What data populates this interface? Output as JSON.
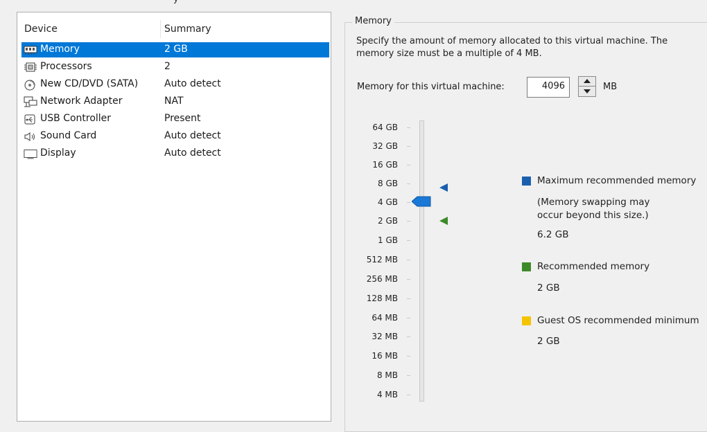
{
  "window": {
    "cropped_title": "y"
  },
  "device_list": {
    "headers": {
      "device": "Device",
      "summary": "Summary"
    },
    "rows": [
      {
        "icon": "memory-icon",
        "name": "Memory",
        "summary": "2 GB",
        "selected": true
      },
      {
        "icon": "processor-icon",
        "name": "Processors",
        "summary": "2",
        "selected": false
      },
      {
        "icon": "cd-dvd-icon",
        "name": "New CD/DVD (SATA)",
        "summary": "Auto detect",
        "selected": false
      },
      {
        "icon": "network-adapter-icon",
        "name": "Network Adapter",
        "summary": "NAT",
        "selected": false
      },
      {
        "icon": "usb-icon",
        "name": "USB Controller",
        "summary": "Present",
        "selected": false
      },
      {
        "icon": "speaker-icon",
        "name": "Sound Card",
        "summary": "Auto detect",
        "selected": false
      },
      {
        "icon": "display-icon",
        "name": "Display",
        "summary": "Auto detect",
        "selected": false
      }
    ]
  },
  "memory": {
    "group_title": "Memory",
    "description": "Specify the amount of memory allocated to this virtual machine. The memory size must be a multiple of 4 MB.",
    "field_label": "Memory for this virtual machine:",
    "value": "4096",
    "unit": "MB",
    "scale": [
      "64 GB",
      "32 GB",
      "16 GB",
      "8 GB",
      "4 GB",
      "2 GB",
      "1 GB",
      "512 MB",
      "256 MB",
      "128 MB",
      "64 MB",
      "32 MB",
      "16 MB",
      "8 MB",
      "4 MB"
    ],
    "current_scale_label": "4 GB",
    "max_marker_label": "8 GB",
    "recommended_marker_label": "2 GB",
    "legend": {
      "max": {
        "title": "Maximum recommended memory",
        "note_line1": "(Memory swapping may",
        "note_line2": "occur beyond this size.)",
        "value": "6.2 GB",
        "color": "#1a5fad"
      },
      "recommended": {
        "title": "Recommended memory",
        "value": "2 GB",
        "color": "#3d8a2a"
      },
      "guest_min": {
        "title": "Guest OS recommended minimum",
        "value": "2 GB",
        "color": "#f5c400"
      }
    }
  }
}
